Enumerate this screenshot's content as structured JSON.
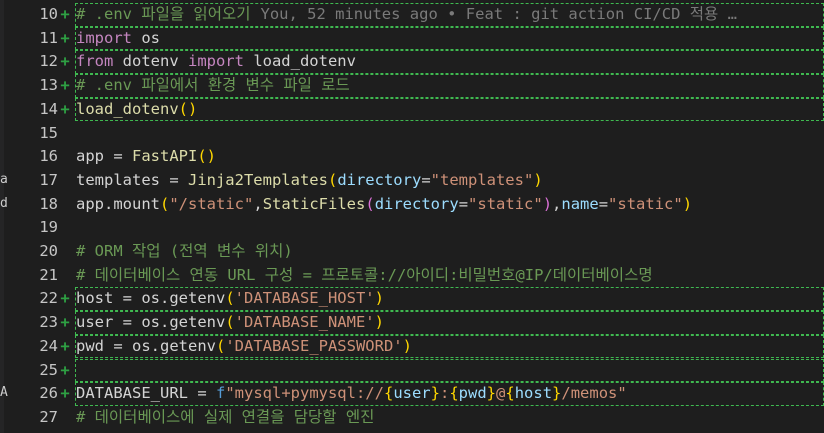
{
  "editor": {
    "blame": "You, 52 minutes ago • Feat : git action CI/CD 적용 …",
    "side_chars": [
      "a",
      "d",
      "A"
    ],
    "lines": [
      {
        "num": "10",
        "mark": "+",
        "tokens": [
          [
            "cm",
            "# .env 파일을 읽어오기"
          ]
        ]
      },
      {
        "num": "11",
        "mark": "+",
        "tokens": [
          [
            "kw",
            "import"
          ],
          [
            "op",
            " os"
          ]
        ]
      },
      {
        "num": "12",
        "mark": "+",
        "tokens": [
          [
            "kw",
            "from"
          ],
          [
            "op",
            " dotenv "
          ],
          [
            "kw",
            "import"
          ],
          [
            "op",
            " load_dotenv"
          ]
        ]
      },
      {
        "num": "13",
        "mark": "+",
        "tokens": [
          [
            "cm",
            "# .env 파일에서 환경 변수 파일 로드"
          ]
        ]
      },
      {
        "num": "14",
        "mark": "+",
        "tokens": [
          [
            "fn",
            "load_dotenv"
          ],
          [
            "br",
            "()"
          ]
        ]
      },
      {
        "num": "15",
        "mark": "",
        "tokens": []
      },
      {
        "num": "16",
        "mark": "",
        "tokens": [
          [
            "op",
            "app = "
          ],
          [
            "fn",
            "FastAPI"
          ],
          [
            "br",
            "()"
          ]
        ]
      },
      {
        "num": "17",
        "mark": "",
        "tokens": [
          [
            "op",
            "templates = "
          ],
          [
            "fn",
            "Jinja2Templates"
          ],
          [
            "br",
            "("
          ],
          [
            "var",
            "directory"
          ],
          [
            "op",
            "="
          ],
          [
            "str",
            "\"templates\""
          ],
          [
            "br",
            ")"
          ]
        ]
      },
      {
        "num": "18",
        "mark": "",
        "tokens": [
          [
            "op",
            "app.mount"
          ],
          [
            "br",
            "("
          ],
          [
            "str",
            "\"/static\""
          ],
          [
            "op",
            ","
          ],
          [
            "fn",
            "StaticFiles"
          ],
          [
            "br2",
            "("
          ],
          [
            "var",
            "directory"
          ],
          [
            "op",
            "="
          ],
          [
            "str",
            "\"static\""
          ],
          [
            "br2",
            ")"
          ],
          [
            "op",
            ","
          ],
          [
            "var",
            "name"
          ],
          [
            "op",
            "="
          ],
          [
            "str",
            "\"static\""
          ],
          [
            "br",
            ")"
          ]
        ]
      },
      {
        "num": "19",
        "mark": "",
        "tokens": []
      },
      {
        "num": "20",
        "mark": "",
        "tokens": [
          [
            "cm",
            "# ORM 작업 (전역 변수 위치)"
          ]
        ]
      },
      {
        "num": "21",
        "mark": "",
        "tokens": [
          [
            "cm",
            "# 데이터베이스 연동 URL 구성 = 프로토콜://아이디:비밀번호@IP/데이터베이스명"
          ]
        ]
      },
      {
        "num": "22",
        "mark": "+",
        "tokens": [
          [
            "op",
            "host = os.getenv"
          ],
          [
            "br",
            "("
          ],
          [
            "str",
            "'DATABASE_HOST'"
          ],
          [
            "br",
            ")"
          ]
        ]
      },
      {
        "num": "23",
        "mark": "+",
        "tokens": [
          [
            "op",
            "user = os.getenv"
          ],
          [
            "br",
            "("
          ],
          [
            "str",
            "'DATABASE_NAME'"
          ],
          [
            "br",
            ")"
          ]
        ]
      },
      {
        "num": "24",
        "mark": "+",
        "tokens": [
          [
            "op",
            "pwd = os.getenv"
          ],
          [
            "br",
            "("
          ],
          [
            "str",
            "'DATABASE_PASSWORD'"
          ],
          [
            "br",
            ")"
          ]
        ]
      },
      {
        "num": "25",
        "mark": "+",
        "tokens": []
      },
      {
        "num": "26",
        "mark": "+",
        "tokens": [
          [
            "op",
            "DATABASE_URL = "
          ],
          [
            "fpre",
            "f"
          ],
          [
            "str",
            "\"mysql+pymysql://"
          ],
          [
            "br",
            "{"
          ],
          [
            "interp",
            "user"
          ],
          [
            "br",
            "}"
          ],
          [
            "str",
            ":"
          ],
          [
            "br",
            "{"
          ],
          [
            "interp",
            "pwd"
          ],
          [
            "br",
            "}"
          ],
          [
            "str",
            "@"
          ],
          [
            "br",
            "{"
          ],
          [
            "interp",
            "host"
          ],
          [
            "br",
            "}"
          ],
          [
            "str",
            "/memos\""
          ]
        ]
      },
      {
        "num": "27",
        "mark": "",
        "tokens": [
          [
            "cm",
            "# 데이터베이스에 실제 연결을 담당할 엔진"
          ]
        ]
      }
    ]
  }
}
